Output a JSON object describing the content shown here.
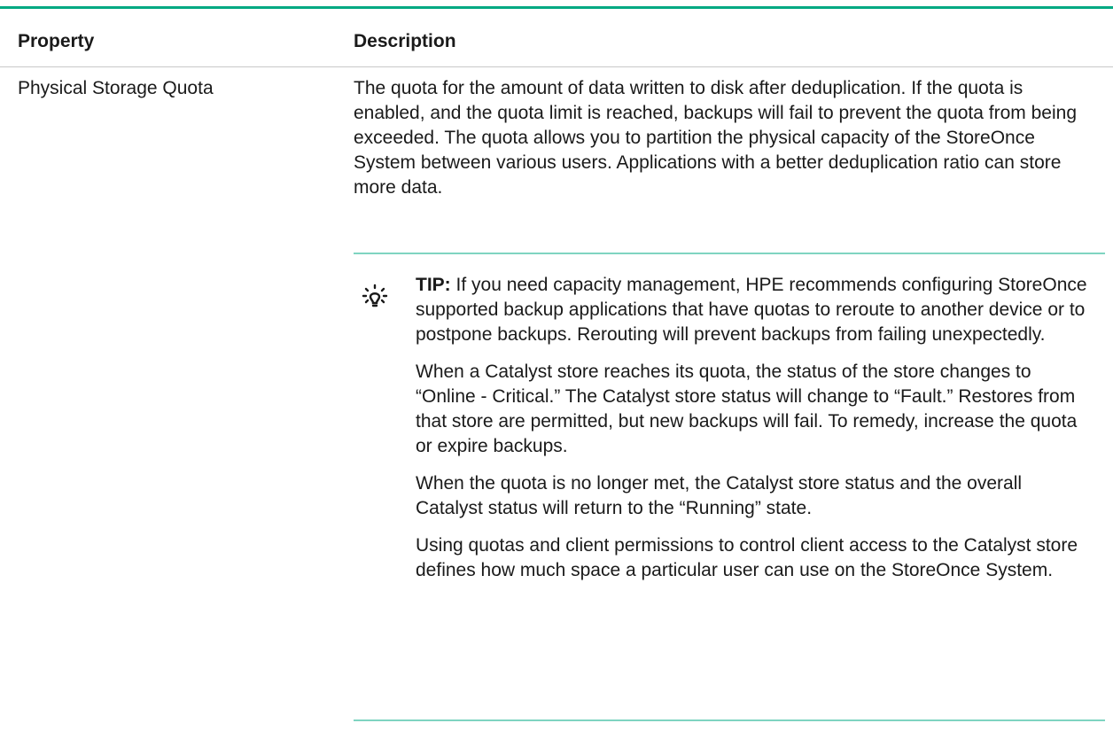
{
  "table": {
    "headers": {
      "property": "Property",
      "description": "Description"
    },
    "row": {
      "property": "Physical Storage Quota",
      "description": "The quota for the amount of data written to disk after deduplication. If the quota is enabled, and the quota limit is reached, backups will fail to prevent the quota from being exceeded. The quota allows you to partition the physical capacity of the StoreOnce System between various users. Applications with a better deduplication ratio can store more data."
    }
  },
  "tip": {
    "icon": "lightbulb-icon",
    "label": "TIP:",
    "text": "If you need capacity management, HPE recommends configuring StoreOnce supported backup applications that have quotas to reroute to another device or to postpone backups. Rerouting will prevent backups from failing unexpectedly.",
    "paragraphs": [
      "When a Catalyst store reaches its quota, the status of the store changes to “Online - Critical.” The Catalyst store status will change to “Fault.” Restores from that store are permitted, but new backups will fail. To remedy, increase the quota or expire backups.",
      "When the quota is no longer met, the Catalyst store status and the overall Catalyst status will return to the “Running” state.",
      "Using quotas and client permissions to control client access to the Catalyst store defines how much space a particular user can use on the StoreOnce System."
    ]
  },
  "colors": {
    "accent": "#01a982",
    "tip_rule": "#7fd4c1"
  }
}
